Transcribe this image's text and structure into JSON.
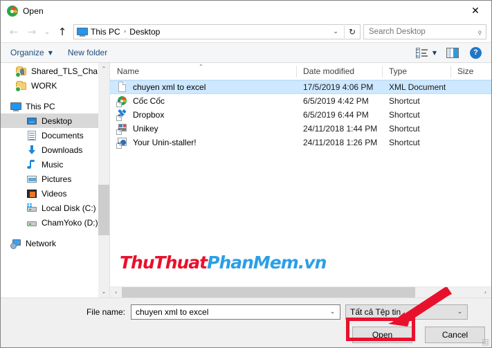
{
  "window": {
    "title": "Open",
    "title_icon": "coccoc-icon",
    "close_label": "✕"
  },
  "nav": {
    "back_icon": "arrow-left-icon",
    "forward_icon": "arrow-right-icon",
    "recent_icon": "chevron-down-icon",
    "up_icon": "arrow-up-icon",
    "breadcrumb": {
      "root_icon": "this-pc-icon",
      "segments": [
        "This PC",
        "Desktop"
      ],
      "separator": "›",
      "dropdown_icon": "chevron-down-icon",
      "refresh_icon": "refresh-icon"
    },
    "search": {
      "placeholder": "Search Desktop",
      "value": "",
      "icon": "search-icon"
    }
  },
  "command_bar": {
    "organize_label": "Organize",
    "organize_caret": "▼",
    "new_folder_label": "New folder",
    "view_icon": "view-list-icon",
    "view_caret": "▼",
    "preview_pane_icon": "preview-pane-icon",
    "help_icon": "help-icon",
    "help_glyph": "?"
  },
  "sidebar": {
    "items": [
      {
        "label": "Shared_TLS_Cha",
        "icon": "shared-folder-icon",
        "indent": 1,
        "selected": false
      },
      {
        "label": "WORK",
        "icon": "shared-folder-icon",
        "indent": 1,
        "selected": false
      },
      {
        "label": "This PC",
        "icon": "this-pc-icon",
        "indent": 0,
        "selected": false
      },
      {
        "label": "Desktop",
        "icon": "desktop-icon",
        "indent": 1,
        "selected": true
      },
      {
        "label": "Documents",
        "icon": "documents-icon",
        "indent": 1,
        "selected": false
      },
      {
        "label": "Downloads",
        "icon": "downloads-icon",
        "indent": 1,
        "selected": false
      },
      {
        "label": "Music",
        "icon": "music-icon",
        "indent": 1,
        "selected": false
      },
      {
        "label": "Pictures",
        "icon": "pictures-icon",
        "indent": 1,
        "selected": false
      },
      {
        "label": "Videos",
        "icon": "videos-icon",
        "indent": 1,
        "selected": false
      },
      {
        "label": "Local Disk (C:)",
        "icon": "local-disk-icon",
        "indent": 1,
        "selected": false
      },
      {
        "label": "ChamYoko (D:)",
        "icon": "drive-icon",
        "indent": 1,
        "selected": false
      },
      {
        "label": "Network",
        "icon": "network-icon",
        "indent": 0,
        "selected": false
      }
    ],
    "scroll_up_glyph": "⌃",
    "scroll_down_glyph": "⌄"
  },
  "file_list": {
    "columns": [
      {
        "key": "name",
        "label": "Name",
        "sorted": true,
        "sort_glyph": "⌃"
      },
      {
        "key": "date",
        "label": "Date modified"
      },
      {
        "key": "type",
        "label": "Type"
      },
      {
        "key": "size",
        "label": "Size"
      }
    ],
    "rows": [
      {
        "name": "chuyen xml to excel",
        "date": "17/5/2019 4:06 PM",
        "type": "XML Document",
        "size": "",
        "icon": "xml-file-icon",
        "selected": true
      },
      {
        "name": "Cốc Cốc",
        "date": "6/5/2019 4:42 PM",
        "type": "Shortcut",
        "size": "",
        "icon": "coccoc-shortcut-icon",
        "selected": false
      },
      {
        "name": "Dropbox",
        "date": "6/5/2019 6:44 PM",
        "type": "Shortcut",
        "size": "",
        "icon": "dropbox-shortcut-icon",
        "selected": false
      },
      {
        "name": "Unikey",
        "date": "24/11/2018 1:44 PM",
        "type": "Shortcut",
        "size": "",
        "icon": "unikey-shortcut-icon",
        "selected": false
      },
      {
        "name": "Your Unin-staller!",
        "date": "24/11/2018 1:26 PM",
        "type": "Shortcut",
        "size": "",
        "icon": "uninstaller-shortcut-icon",
        "selected": false
      }
    ],
    "scroll_left_glyph": "‹",
    "scroll_right_glyph": "›"
  },
  "watermark": {
    "part1": "ThuThuat",
    "part2": "PhanMem.vn",
    "color1": "#e8112d",
    "color2": "#2b9fe6"
  },
  "footer": {
    "filename_label": "File name:",
    "filename_value": "chuyen xml to excel",
    "filename_placeholder": "File name",
    "filename_caret": "⌄",
    "filter_value": "Tất cả Tệp tin",
    "filter_caret": "⌄",
    "open_label": "Open",
    "cancel_label": "Cancel"
  },
  "annotations": {
    "highlight_color": "#e8112d",
    "highlight_target": "open-button",
    "arrow_target": "open-button"
  }
}
